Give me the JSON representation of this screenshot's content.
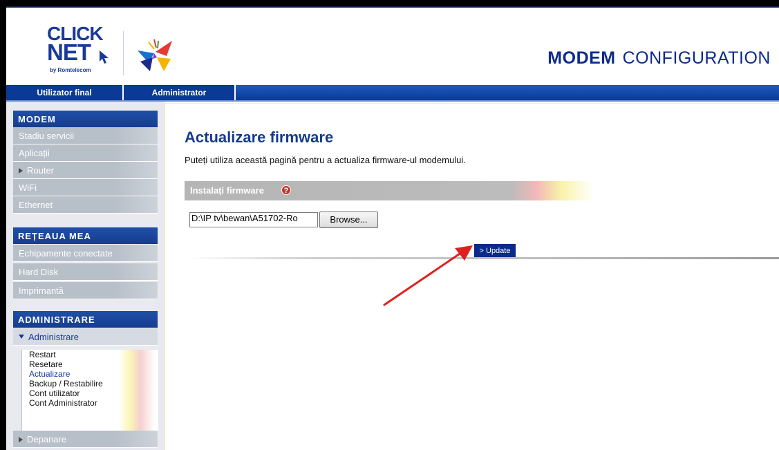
{
  "header": {
    "logo_line1": "CLICK",
    "logo_line2": "NET",
    "logo_sub": "by Romtelecom",
    "title_bold": "MODEM",
    "title_rest": "CONFIGURATION"
  },
  "nav": {
    "tabs": [
      {
        "label": "Utilizator final"
      },
      {
        "label": "Administrator"
      }
    ]
  },
  "sidebar": {
    "sections": [
      {
        "title": "MODEM",
        "items": [
          "Stadiu servicii",
          "Aplicații",
          "Router",
          "WiFi",
          "Ethernet"
        ]
      },
      {
        "title": "REȚEAUA MEA",
        "items": [
          "Echipamente conectate",
          "Hard Disk",
          "Imprimantă"
        ]
      },
      {
        "title": "ADMINISTRARE",
        "open_item": "Administrare",
        "submenu": [
          "Restart",
          "Resetare",
          "Actualizare",
          "Backup / Restabilire",
          "Cont utilizator",
          "Cont Administrator"
        ],
        "active_submenu": "Actualizare",
        "after_item": "Depanare"
      }
    ]
  },
  "main": {
    "title": "Actualizare firmware",
    "description": "Puteți utiliza această pagină pentru a actualiza firmware-ul modemului.",
    "section_label": "Instalați firmware",
    "help_glyph": "?",
    "file_value": "D:\\IP tv\\bewan\\A51702-Ro",
    "browse_label": "Browse...",
    "update_label": "> Update"
  },
  "colors": {
    "brand_blue": "#0b2a8c",
    "nav_blue": "#0a3a95",
    "annotation_arrow": "#e02020"
  }
}
